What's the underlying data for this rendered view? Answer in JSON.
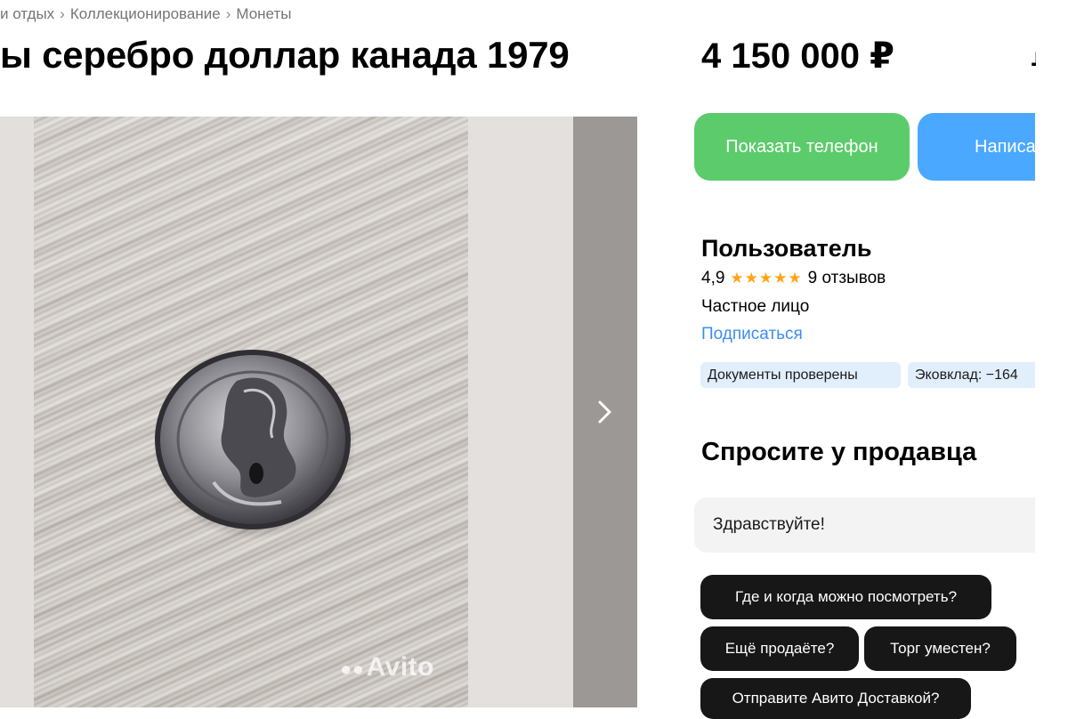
{
  "breadcrumb": {
    "items": [
      "и отдых",
      "Коллекционирование",
      "Монеты"
    ],
    "separator": "›"
  },
  "listing": {
    "title": "ы серебро доллар канада 1979",
    "price": "4 150 000 ₽",
    "price_next_glyph": "₽",
    "watermark": "Avito",
    "photo_icon": "coin-photo"
  },
  "actions": {
    "show_phone": "Показать телефон",
    "write_message": "Написать"
  },
  "seller": {
    "name": "Пользователь",
    "rating": "4,9",
    "stars": "★★★★★",
    "reviews": "9 отзывов",
    "type": "Частное лицо",
    "subscribe": "Подписаться",
    "badges": [
      "Документы проверены",
      "Эковклад: −164"
    ]
  },
  "ask_seller": {
    "title": "Спросите у продавца",
    "input_value": "Здравствуйте!",
    "quick_questions": [
      "Где и когда можно посмотреть?",
      "Ещё продаёте?",
      "Торг уместен?",
      "Отправите Авито Доставкой?"
    ]
  },
  "colors": {
    "phone_button": "#5ccb6b",
    "write_button": "#4aa8ff",
    "link": "#3d8ef0",
    "star": "#ffa415",
    "badge_bg": "#e1eefc",
    "chip_bg": "#171717"
  }
}
